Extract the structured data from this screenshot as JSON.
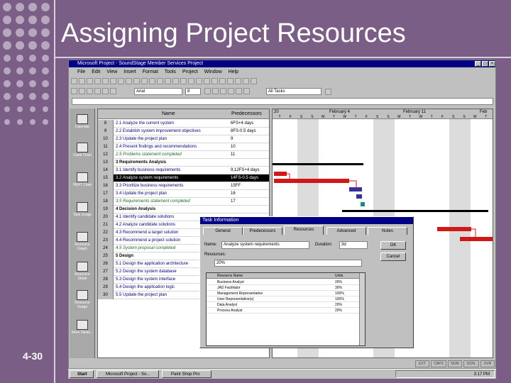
{
  "slide": {
    "title": "Assigning Project Resources",
    "page_number": "4-30"
  },
  "window": {
    "title": "Microsoft Project - SoundStage Member Services Project"
  },
  "menu": [
    "File",
    "Edit",
    "View",
    "Insert",
    "Format",
    "Tools",
    "Project",
    "Window",
    "Help"
  ],
  "toolbar": {
    "font": "Arial",
    "size": "8",
    "filter": "All Tasks"
  },
  "views": [
    "Calendar",
    "Gantt Chart",
    "PERT Chart",
    "Task Usage",
    "Resource Graph",
    "Resource Sheet",
    "Resource Usage",
    "More Views..."
  ],
  "grid": {
    "headers": {
      "name": "Name",
      "predecessors": "Predecessors"
    },
    "rows": [
      {
        "id": "8",
        "name": "2.1 Analyze the current system",
        "pred": "6FS+4 days",
        "kind": "task"
      },
      {
        "id": "9",
        "name": "2.2 Establish system improvement objectives",
        "pred": "8FS-0.5 days",
        "kind": "task"
      },
      {
        "id": "10",
        "name": "2.3 Update the project plan",
        "pred": "9",
        "kind": "task"
      },
      {
        "id": "11",
        "name": "2.4 Present findings and recommendations",
        "pred": "10",
        "kind": "task"
      },
      {
        "id": "12",
        "name": "2.5 Problems statement completed",
        "pred": "11",
        "kind": "milestone"
      },
      {
        "id": "13",
        "name": "3 Requirements Analysis",
        "pred": "",
        "kind": "summary"
      },
      {
        "id": "14",
        "name": "3.1 Identify business requirements",
        "pred": "9,12FS+4 days",
        "kind": "task"
      },
      {
        "id": "15",
        "name": "3.2 Analyze system requirements",
        "pred": "14FS-0.5 days",
        "kind": "selected"
      },
      {
        "id": "16",
        "name": "3.3 Prioritize business requirements",
        "pred": "15FF",
        "kind": "task"
      },
      {
        "id": "17",
        "name": "3.4 Update the project plan",
        "pred": "16",
        "kind": "task"
      },
      {
        "id": "18",
        "name": "3.5 Requirements statement completed",
        "pred": "17",
        "kind": "milestone"
      },
      {
        "id": "19",
        "name": "4 Decision Analysis",
        "pred": "",
        "kind": "summary"
      },
      {
        "id": "20",
        "name": "4.1 Identify candidate solutions",
        "pred": "",
        "kind": "task"
      },
      {
        "id": "21",
        "name": "4.2 Analyze candidate solutions",
        "pred": "",
        "kind": "task"
      },
      {
        "id": "22",
        "name": "4.3 Recommend a target solution",
        "pred": "",
        "kind": "task"
      },
      {
        "id": "23",
        "name": "4.4 Recommend a project solution",
        "pred": "",
        "kind": "task"
      },
      {
        "id": "24",
        "name": "4.5 System proposal completed",
        "pred": "",
        "kind": "milestone"
      },
      {
        "id": "25",
        "name": "5 Design",
        "pred": "",
        "kind": "summary"
      },
      {
        "id": "26",
        "name": "5.1 Design the application architecture",
        "pred": "",
        "kind": "task"
      },
      {
        "id": "27",
        "name": "5.2 Design the system database",
        "pred": "",
        "kind": "task"
      },
      {
        "id": "28",
        "name": "5.3 Design the system interface",
        "pred": "",
        "kind": "task"
      },
      {
        "id": "29",
        "name": "5.4 Design the application logic",
        "pred": "",
        "kind": "task"
      },
      {
        "id": "30",
        "name": "5.5 Update the project plan",
        "pred": "",
        "kind": "task"
      }
    ]
  },
  "timescale": {
    "weeks": [
      "20",
      "February 4",
      "February 11",
      "Feb"
    ],
    "days": [
      "T",
      "F",
      "S",
      "S",
      "M",
      "T",
      "W",
      "T",
      "F",
      "S",
      "S",
      "M",
      "T",
      "W",
      "T",
      "F",
      "S",
      "S",
      "M",
      "T"
    ]
  },
  "dialog": {
    "title": "Task Information",
    "tabs": [
      "General",
      "Predecessors",
      "Resources",
      "Advanced",
      "Notes"
    ],
    "name_label": "Name:",
    "name_value": "Analyze system requirements",
    "duration_label": "Duration:",
    "duration_value": "3d",
    "ok": "OK",
    "cancel": "Cancel",
    "resources_label": "Resources:",
    "edit_value": "20%",
    "col_name": "Resource Name",
    "col_units": "Units",
    "resources": [
      {
        "name": "Business Analyst",
        "units": "20%"
      },
      {
        "name": "JAD Facilitator",
        "units": "30%"
      },
      {
        "name": "Management Representative",
        "units": "100%"
      },
      {
        "name": "User Representative(s)",
        "units": "100%"
      },
      {
        "name": "Data Analyst",
        "units": "20%"
      },
      {
        "name": "Process Analyst",
        "units": "20%"
      }
    ]
  },
  "status": [
    "EXT",
    "CAPS",
    "NUM",
    "SCRL",
    "OVR"
  ],
  "taskbar": {
    "start": "Start",
    "items": [
      "Microsoft Project - So...",
      "Paint Shop Pro"
    ],
    "clock": "3:17 PM"
  },
  "colors": {
    "background": "#7a5e86",
    "dots": "#b7a8c0",
    "summary_bar": "#000000",
    "task_bar_red": "#d01818",
    "task_bar_blue": "#3b2f9a"
  }
}
